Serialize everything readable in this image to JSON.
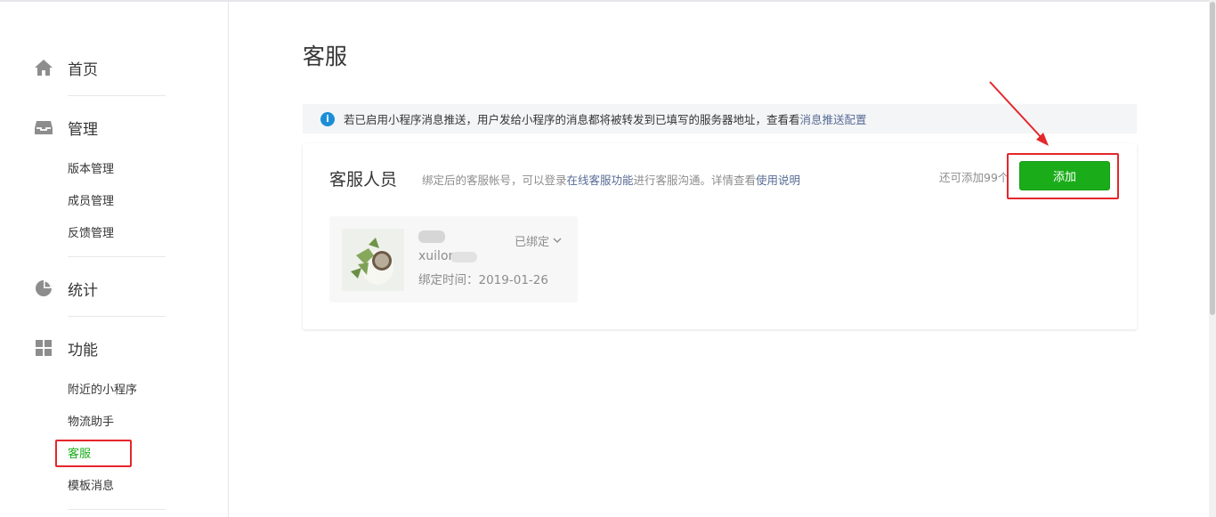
{
  "sidebar": {
    "home": {
      "label": "首页",
      "icon": "home-icon"
    },
    "manage": {
      "label": "管理",
      "icon": "inbox-icon",
      "items": [
        {
          "label": "版本管理"
        },
        {
          "label": "成员管理"
        },
        {
          "label": "反馈管理"
        }
      ]
    },
    "stats": {
      "label": "统计",
      "icon": "pie-chart-icon"
    },
    "features": {
      "label": "功能",
      "icon": "grid-icon",
      "items": [
        {
          "label": "附近的小程序"
        },
        {
          "label": "物流助手"
        },
        {
          "label": "客服",
          "active": true
        },
        {
          "label": "模板消息"
        }
      ]
    }
  },
  "main": {
    "title": "客服",
    "notice": {
      "text": "若已启用小程序消息推送，用户发给小程序的消息都将被转发到已填写的服务器地址，查看看",
      "link": "消息推送配置"
    },
    "panel": {
      "title": "客服人员",
      "desc_prefix": "绑定后的客服帐号，可以登录",
      "desc_link1": "在线客服功能",
      "desc_middle": "进行客服沟通。详情查看",
      "desc_link2": "使用说明",
      "remain": "还可添加99个",
      "add_button": "添加"
    },
    "card": {
      "id": "xuilon",
      "status": "已绑定",
      "bind_time": "绑定时间：2019-01-26"
    }
  },
  "colors": {
    "accent": "#1aad19",
    "link": "#576b95",
    "highlight": "#e5262b",
    "info": "#1a8fd8"
  }
}
